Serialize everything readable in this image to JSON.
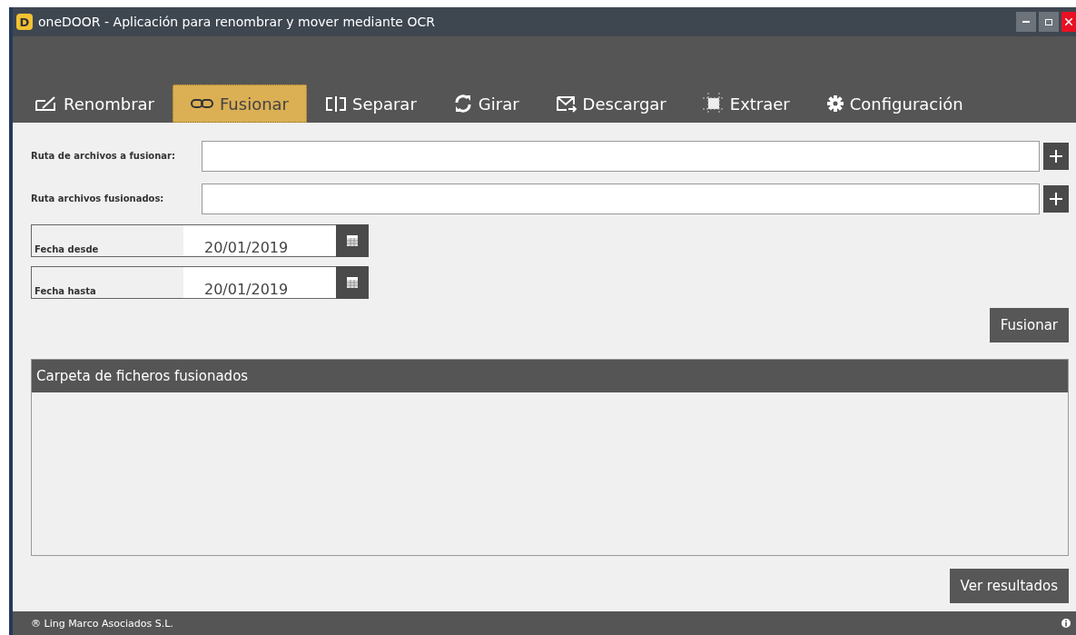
{
  "window": {
    "logo": "D",
    "title": "oneDOOR - Aplicación para renombrar y mover mediante OCR"
  },
  "tabs": [
    {
      "label": "Renombrar",
      "selected": false
    },
    {
      "label": "Fusionar",
      "selected": true
    },
    {
      "label": "Separar",
      "selected": false
    },
    {
      "label": "Girar",
      "selected": false
    },
    {
      "label": "Descargar",
      "selected": false
    },
    {
      "label": "Extraer",
      "selected": false
    },
    {
      "label": "Configuración",
      "selected": false
    }
  ],
  "path_fields": [
    {
      "label": "Ruta de archivos a fusionar:"
    },
    {
      "label": "Ruta archivos fusionados:"
    }
  ],
  "date_fields": [
    {
      "label": "Fecha desde",
      "value": "20/01/2019"
    },
    {
      "label": "Fecha hasta",
      "value": "20/01/2019"
    }
  ],
  "merge_button": "Fusionar",
  "results_panel": {
    "title": "Carpeta de ficheros fusionados"
  },
  "results_button": "Ver resultados",
  "status_bar": {
    "text": "® Ling Marco Asociados S.L."
  }
}
